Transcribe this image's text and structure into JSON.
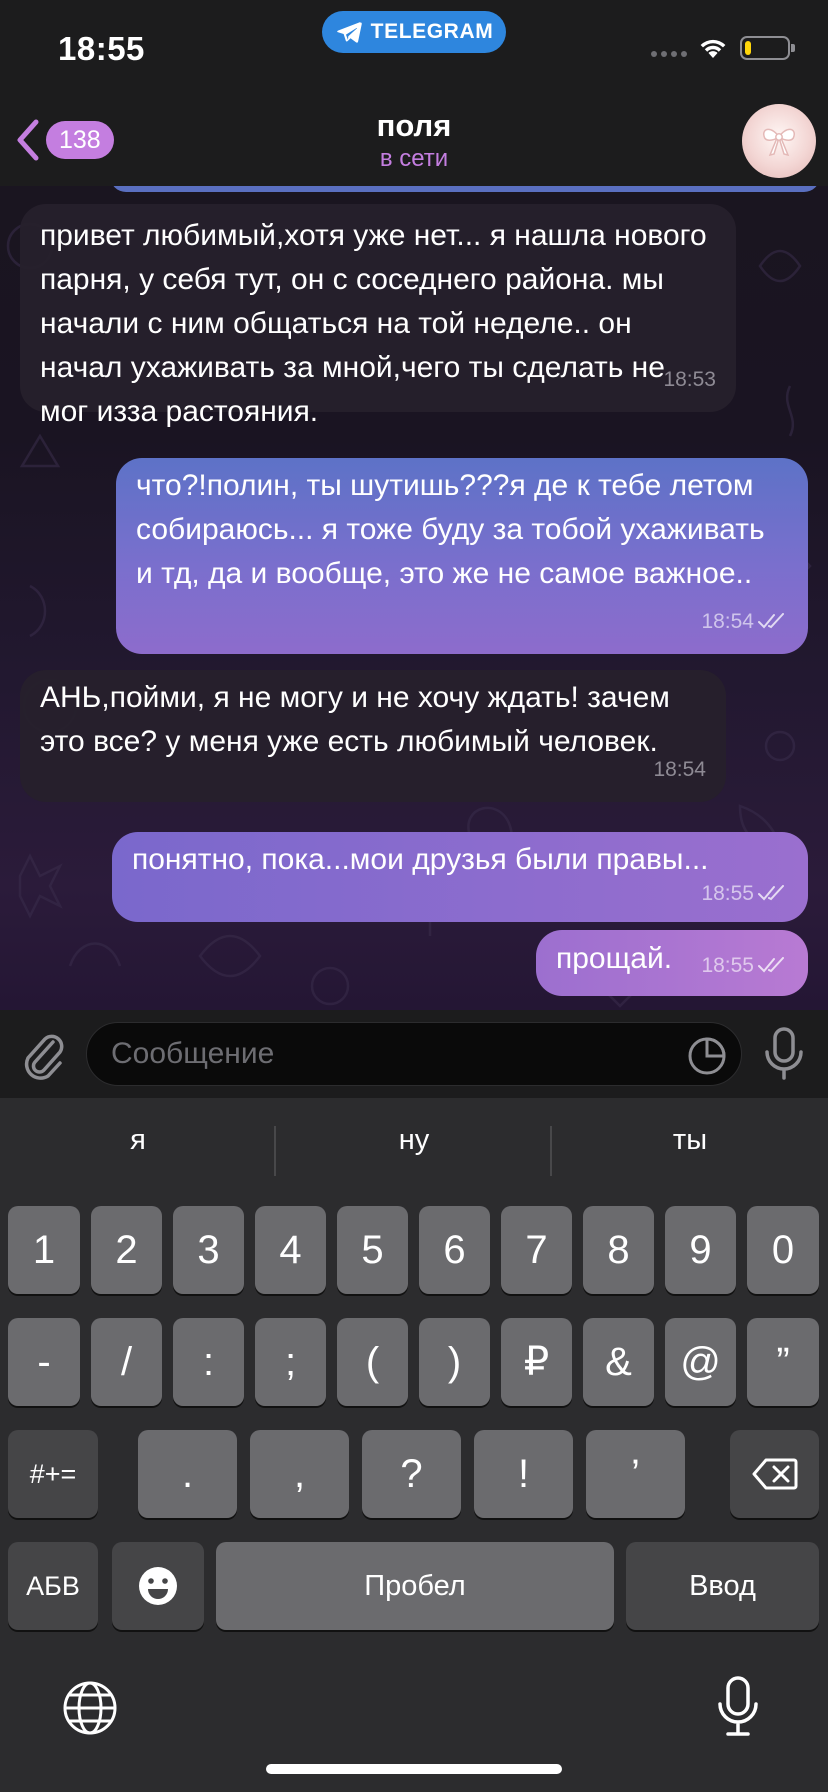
{
  "status_bar": {
    "time": "18:55",
    "app_pill": "TELEGRAM",
    "battery_level": 0.15
  },
  "header": {
    "back_count": "138",
    "title": "поля",
    "status": "в сети"
  },
  "messages": [
    {
      "direction": "in",
      "text": "привет любимый,хотя уже нет... я нашла нового парня, у себя тут, он с соседнего района. мы начали с ним общаться на той неделе.. он начал ухаживать за мной,чего ты сделать не мог изза растояния.",
      "time": "18:53"
    },
    {
      "direction": "out",
      "text": "что?!полин, ты шутишь???я де к тебе летом собираюсь... я тоже буду за тобой ухаживать и тд, да и вообще, это же не самое важное..",
      "time": "18:54",
      "read": true
    },
    {
      "direction": "in",
      "text": "АНЬ,пойми, я не могу и не хочу ждать! зачем это все? у меня уже есть любимый человек.",
      "time": "18:54"
    },
    {
      "direction": "out",
      "text": "понятно, пока...мои друзья были правы...",
      "time": "18:55",
      "read": true
    },
    {
      "direction": "out",
      "text": "прощай.",
      "time": "18:55",
      "read": true
    }
  ],
  "composer": {
    "placeholder": "Сообщение",
    "value": ""
  },
  "keyboard": {
    "suggestions": [
      "я",
      "ну",
      "ты"
    ],
    "row1": [
      "1",
      "2",
      "3",
      "4",
      "5",
      "6",
      "7",
      "8",
      "9",
      "0"
    ],
    "row2": [
      "-",
      "/",
      ":",
      ";",
      "(",
      ")",
      "₽",
      "&",
      "@",
      "”"
    ],
    "row3_mode": "#+=",
    "row3": [
      ".",
      ",",
      "?",
      "!",
      "’"
    ],
    "row4_mode": "АБВ",
    "space": "Пробел",
    "return": "Ввод"
  },
  "colors": {
    "accent": "#c47ee0",
    "pill": "#2e86de",
    "outgoing": "#6c70cc",
    "incoming": "#26202c"
  }
}
